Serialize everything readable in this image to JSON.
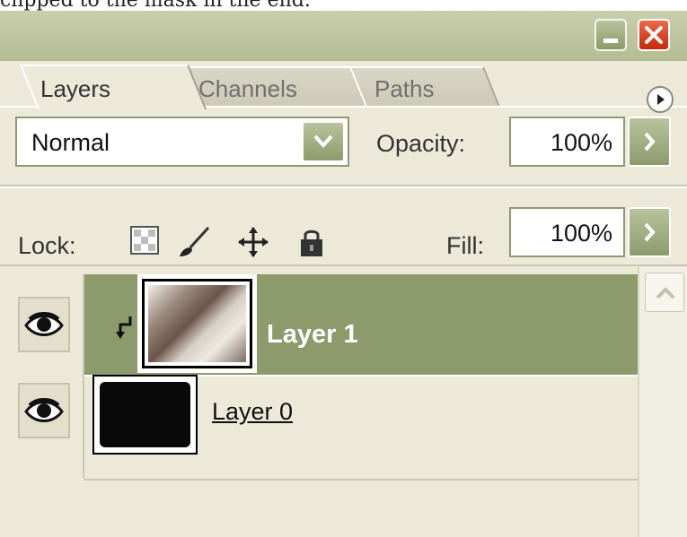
{
  "caption": {
    "text": "clipped to the mask in the end."
  },
  "window": {
    "minimize_label": "minimize",
    "close_label": "close"
  },
  "tabs": [
    {
      "label": "Layers",
      "active": true
    },
    {
      "label": "Channels",
      "active": false
    },
    {
      "label": "Paths",
      "active": false
    }
  ],
  "blend": {
    "mode": "Normal"
  },
  "opacity": {
    "label": "Opacity:",
    "value": "100%"
  },
  "lock": {
    "label": "Lock:",
    "icons": [
      "transparency-icon",
      "brush-icon",
      "move-icon",
      "padlock-icon"
    ]
  },
  "fill": {
    "label": "Fill:",
    "value": "100%"
  },
  "layers": [
    {
      "name": "Layer 1",
      "selected": true,
      "visible": true,
      "clipped": true
    },
    {
      "name": "Layer 0",
      "selected": false,
      "visible": true,
      "clipped": false
    }
  ],
  "colors": {
    "panel_bg": "#ece9d8",
    "selected_row": "#8d9a6b",
    "accent_button": "#8d9b6d",
    "close_button": "#c52a0c"
  }
}
